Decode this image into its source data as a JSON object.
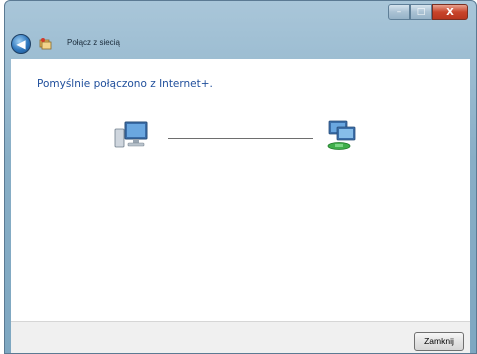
{
  "window": {
    "title": "Połącz z siecią",
    "controls": {
      "minimize": "–",
      "maximize": "□",
      "close": "X"
    }
  },
  "nav": {
    "back_icon": "back-arrow-icon",
    "back_glyph": "◀"
  },
  "content": {
    "heading": "Pomyślnie połączono z Internet+.",
    "left_icon": "computer-icon",
    "right_icon": "network-icon"
  },
  "footer": {
    "close_label": "Zamknij"
  },
  "colors": {
    "heading": "#1f4e9b",
    "frame": "#88aec6",
    "close_caption": "#c8442b"
  }
}
